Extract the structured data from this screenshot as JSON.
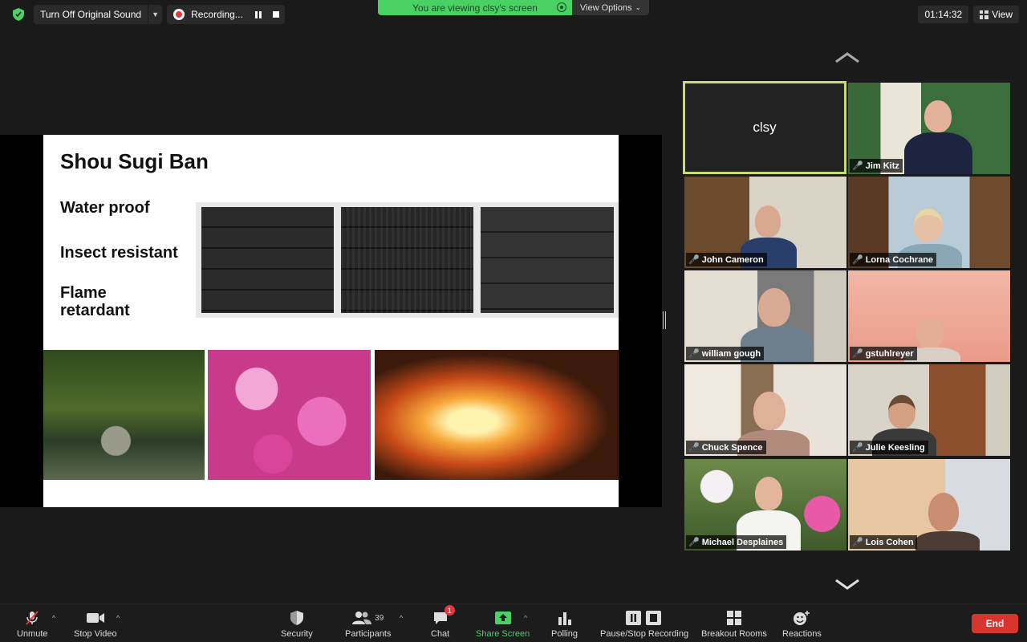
{
  "topbar": {
    "sound_label": "Turn Off Original Sound",
    "recording_label": "Recording...",
    "banner_text": "You are viewing clsy's screen",
    "view_options": "View Options",
    "timer": "01:14:32",
    "view_label": "View"
  },
  "slide": {
    "title": "Shou Sugi Ban",
    "bullets": [
      "Water proof",
      "Insect resistant",
      "Flame retardant"
    ]
  },
  "gallery": {
    "active_speaker": "clsy",
    "participants": [
      {
        "name": "Jim Kitz"
      },
      {
        "name": "John Cameron"
      },
      {
        "name": "Lorna Cochrane"
      },
      {
        "name": "william gough"
      },
      {
        "name": "gstuhlreyer"
      },
      {
        "name": "Chuck Spence"
      },
      {
        "name": "Julie  Keesling"
      },
      {
        "name": "Michael Desplaines"
      },
      {
        "name": "Lois Cohen"
      }
    ]
  },
  "toolbar": {
    "unmute": "Unmute",
    "stop_video": "Stop Video",
    "security": "Security",
    "participants": "Participants",
    "participants_count": "39",
    "chat": "Chat",
    "chat_badge": "1",
    "share_screen": "Share Screen",
    "polling": "Polling",
    "pause_recording": "Pause/Stop Recording",
    "breakout_rooms": "Breakout Rooms",
    "reactions": "Reactions",
    "end": "End"
  },
  "colors": {
    "banner_green": "#4ad163",
    "active_border": "#c9dd6a",
    "end_red": "#d9352f",
    "muted_red": "#e0383c"
  }
}
